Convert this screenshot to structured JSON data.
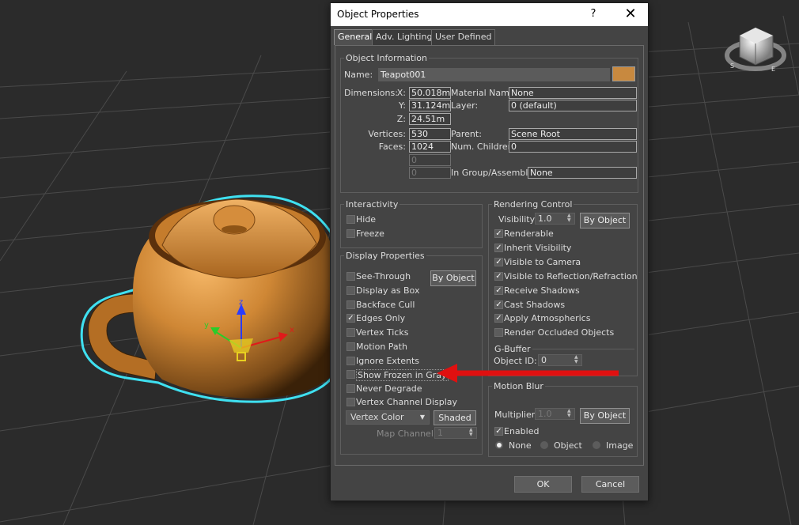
{
  "dialog": {
    "title": "Object Properties",
    "help": "?",
    "close": "✕",
    "tabs": [
      "General",
      "Adv. Lighting",
      "User Defined"
    ]
  },
  "object_info": {
    "title": "Object Information",
    "name_label": "Name:",
    "name_value": "Teapot001",
    "color": "#c8893f",
    "dimensions_label": "Dimensions:",
    "x_label": "X:",
    "x_value": "50.018m",
    "y_label": "Y:",
    "y_value": "31.124m",
    "z_label": "Z:",
    "z_value": "24.51m",
    "material_label": "Material Name:",
    "material_value": "None",
    "layer_label": "Layer:",
    "layer_value": "0 (default)",
    "vertices_label": "Vertices:",
    "vertices_value": "530",
    "faces_label": "Faces:",
    "faces_value": "1024",
    "blank1": "0",
    "blank2": "0",
    "parent_label": "Parent:",
    "parent_value": "Scene Root",
    "children_label": "Num. Children:",
    "children_value": "0",
    "group_label": "In Group/Assembly:",
    "group_value": "None"
  },
  "interactivity": {
    "title": "Interactivity",
    "items": [
      {
        "label": "Hide",
        "checked": false
      },
      {
        "label": "Freeze",
        "checked": false
      }
    ]
  },
  "display": {
    "title": "Display Properties",
    "by_object": "By Object",
    "items": [
      {
        "label": "See-Through",
        "checked": false
      },
      {
        "label": "Display as Box",
        "checked": false
      },
      {
        "label": "Backface Cull",
        "checked": false
      },
      {
        "label": "Edges Only",
        "checked": true
      },
      {
        "label": "Vertex Ticks",
        "checked": false
      },
      {
        "label": "Motion Path",
        "checked": false
      },
      {
        "label": "Ignore Extents",
        "checked": false
      },
      {
        "label": "Show Frozen in Gray",
        "checked": false
      },
      {
        "label": "Never Degrade",
        "checked": false
      },
      {
        "label": "Vertex Channel Display",
        "checked": false
      }
    ],
    "vertex_color": "Vertex Color",
    "shaded": "Shaded",
    "map_channel_label": "Map Channel:",
    "map_channel_value": "1"
  },
  "rendering": {
    "title": "Rendering Control",
    "visibility_label": "Visibility:",
    "visibility_value": "1.0",
    "by_object": "By Object",
    "items": [
      {
        "label": "Renderable",
        "checked": true
      },
      {
        "label": "Inherit Visibility",
        "checked": true
      },
      {
        "label": "Visible to Camera",
        "checked": true
      },
      {
        "label": "Visible to Reflection/Refraction",
        "checked": true
      },
      {
        "label": "Receive Shadows",
        "checked": true
      },
      {
        "label": "Cast Shadows",
        "checked": true
      },
      {
        "label": "Apply Atmospherics",
        "checked": true
      },
      {
        "label": "Render Occluded Objects",
        "checked": false
      }
    ]
  },
  "gbuffer": {
    "title": "G-Buffer",
    "object_id_label": "Object ID:",
    "object_id_value": "0"
  },
  "motion_blur": {
    "title": "Motion Blur",
    "multiplier_label": "Multiplier:",
    "multiplier_value": "1.0",
    "by_object": "By Object",
    "enabled_label": "Enabled",
    "enabled": true,
    "options": [
      {
        "label": "None",
        "selected": true
      },
      {
        "label": "Object",
        "selected": false
      },
      {
        "label": "Image",
        "selected": false
      }
    ]
  },
  "footer": {
    "ok": "OK",
    "cancel": "Cancel"
  },
  "colors": {
    "viewport_bg": "#2b2b2b",
    "dialog_bg": "#444444",
    "teapot": "#c47a28",
    "selection_outline": "#3fe0f0",
    "annotation_arrow": "#e01010"
  }
}
